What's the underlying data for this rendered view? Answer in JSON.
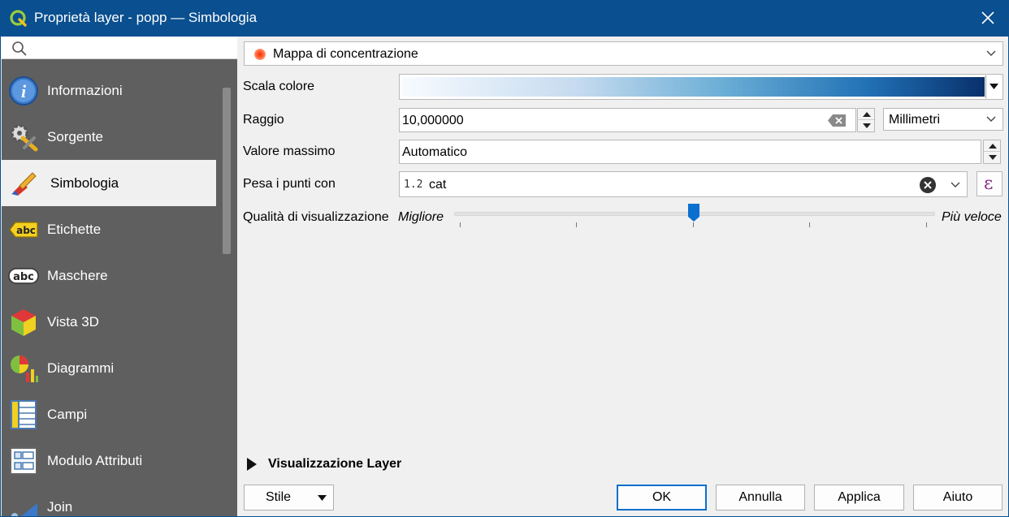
{
  "window": {
    "title": "Proprietà layer - popp — Simbologia"
  },
  "search": {
    "placeholder": ""
  },
  "nav": {
    "items": [
      {
        "label": "Informazioni",
        "icon": "info-icon"
      },
      {
        "label": "Sorgente",
        "icon": "source-gear-icon"
      },
      {
        "label": "Simbologia",
        "icon": "symbology-brush-icon",
        "active": true
      },
      {
        "label": "Etichette",
        "icon": "labels-abc-icon"
      },
      {
        "label": "Maschere",
        "icon": "masks-abc-icon"
      },
      {
        "label": "Vista 3D",
        "icon": "cube-3d-icon"
      },
      {
        "label": "Diagrammi",
        "icon": "diagram-icon"
      },
      {
        "label": "Campi",
        "icon": "fields-icon"
      },
      {
        "label": "Modulo Attributi",
        "icon": "attribute-form-icon"
      },
      {
        "label": "Join",
        "icon": "join-icon"
      }
    ]
  },
  "renderer": {
    "selected": "Mappa di concentrazione"
  },
  "fields": {
    "color_ramp_label": "Scala colore",
    "radius_label": "Raggio",
    "radius_value": "10,000000",
    "radius_unit": "Millimetri",
    "max_value_label": "Valore massimo",
    "max_value": "Automatico",
    "weight_label": "Pesa i punti con",
    "weight_type": "1.2",
    "weight_value": "cat",
    "quality_label": "Qualità di visualizzazione",
    "quality_min": "Migliore",
    "quality_max": "Più veloce",
    "quality_level": 0.5
  },
  "layer_rendering": {
    "label": "Visualizzazione Layer"
  },
  "buttons": {
    "style": "Stile",
    "ok": "OK",
    "cancel": "Annulla",
    "apply": "Applica",
    "help": "Aiuto"
  },
  "colors": {
    "titlebar": "#0a4f8f",
    "sidebar": "#5f5f5f",
    "accent": "#0a6fce"
  }
}
